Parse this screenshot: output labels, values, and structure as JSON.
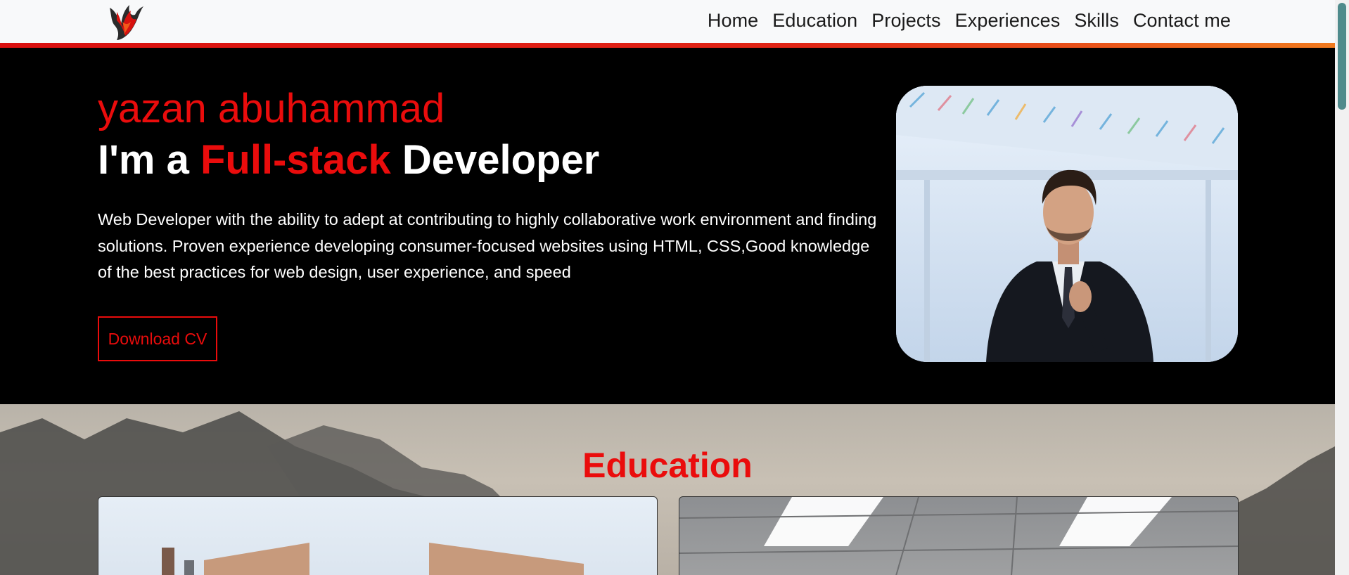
{
  "nav": {
    "logo_icon": "flame-logo-icon",
    "links": [
      "Home",
      "Education",
      "Projects",
      "Experiences",
      "Skills",
      "Contact me"
    ]
  },
  "hero": {
    "name": "yazan abuhammad",
    "role_prefix": "I'm a ",
    "role_accent": "Full-stack",
    "role_suffix": " Developer",
    "description": "Web Developer with the ability to adept at contributing to highly collaborative work environment and finding solutions. Proven experience developing consumer-focused websites using HTML, CSS,Good knowledge of the best practices for web design, user experience, and speed",
    "cv_button": "Download CV"
  },
  "education": {
    "title": "Education"
  },
  "colors": {
    "accent": "#ea0c0c",
    "navbar_bg": "#f8f9fa",
    "hero_bg": "#000000",
    "scroll_thumb": "#4f8b8c"
  }
}
